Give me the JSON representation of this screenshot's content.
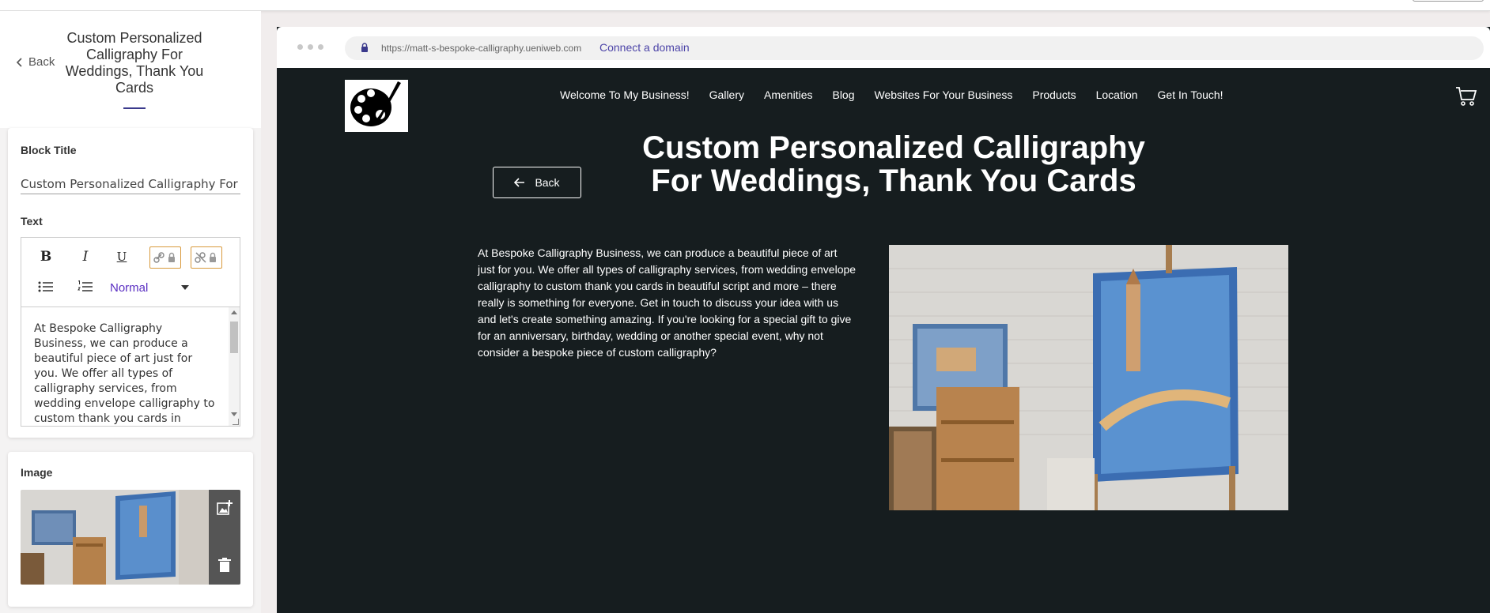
{
  "sidebar": {
    "back_label": "Back",
    "page_title": "Custom Personalized Calligraphy For Weddings, Thank You Cards",
    "block_title_label": "Block Title",
    "block_title_value": "Custom Personalized Calligraphy For Weddings, Thank You Cards",
    "text_label": "Text",
    "toolbar": {
      "bold": "B",
      "italic": "I",
      "underline": "U",
      "format_value": "Normal"
    },
    "editor_text": "At Bespoke Calligraphy Business, we can produce a beautiful piece of art just for you. We offer all types of calligraphy services, from wedding envelope calligraphy to custom thank you cards in beautiful script and more – there really is something for everyone.",
    "image_label": "Image"
  },
  "browser": {
    "url": "https://matt-s-bespoke-calligraphy.ueniweb.com",
    "connect_label": "Connect a domain"
  },
  "site": {
    "nav": [
      "Welcome To My Business!",
      "Gallery",
      "Amenities",
      "Blog",
      "Websites For Your Business",
      "Products",
      "Location",
      "Get In Touch!"
    ],
    "title": "Custom Personalized Calligraphy For Weddings, Thank You Cards",
    "back_label": "Back",
    "body": "At Bespoke Calligraphy Business, we can produce a beautiful piece of art just for you. We offer all types of calligraphy services, from wedding envelope calligraphy to custom thank you cards in beautiful script and more – there really is something for everyone. Get in touch to discuss your idea with us and let's create something amazing. If you're looking for a special gift to give for an anniversary, birthday, wedding or another special event, why not consider a bespoke piece of custom calligraphy?"
  },
  "colors": {
    "accent": "#3b3a8c",
    "link_lock_border": "#d89a3c",
    "format_text": "#5a2ec2",
    "site_bg": "#161d1f"
  },
  "icons": [
    "chevron-left-icon",
    "link-lock-icon",
    "unlink-lock-icon",
    "bullet-list-icon",
    "ordered-list-icon",
    "add-image-icon",
    "trash-icon",
    "lock-icon",
    "cart-icon",
    "arrow-left-icon",
    "palette-logo"
  ]
}
